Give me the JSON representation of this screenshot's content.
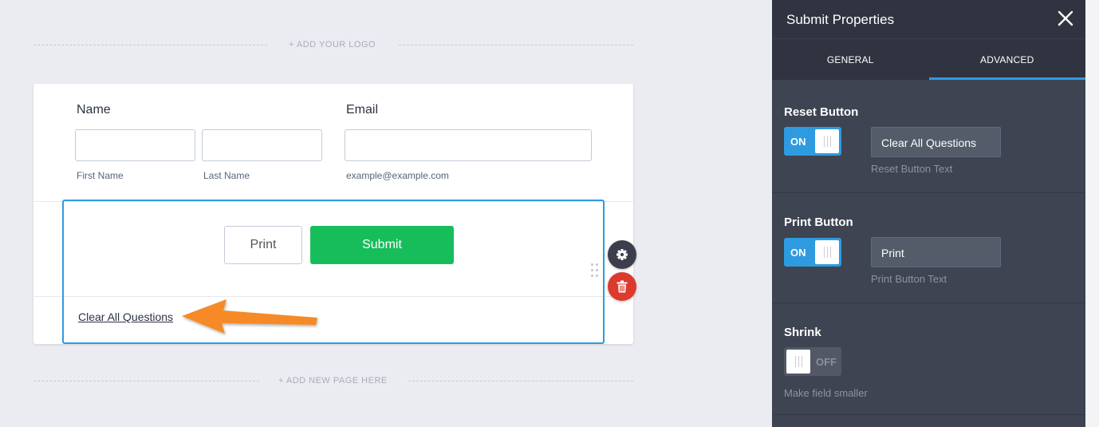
{
  "canvas": {
    "add_logo": "+ ADD YOUR LOGO",
    "add_page": "+ ADD NEW PAGE HERE"
  },
  "form": {
    "name_label": "Name",
    "email_label": "Email",
    "first_name_sub": "First Name",
    "last_name_sub": "Last Name",
    "email_sub": "example@example.com",
    "print_label": "Print",
    "submit_label": "Submit",
    "reset_label": "Clear All Questions",
    "submit_color": "#18bd5b",
    "selection_color": "#2e9be0"
  },
  "icons": {
    "settings": "gear-icon",
    "delete": "trash-icon",
    "drag": "drag-handle-icon",
    "pointer": "arrow-annotation",
    "close": "close-icon"
  },
  "panel": {
    "title": "Submit Properties",
    "tabs": [
      "GENERAL",
      "ADVANCED"
    ],
    "active_tab": "ADVANCED",
    "reset": {
      "title": "Reset Button",
      "toggle": "ON",
      "value": "Clear All Questions",
      "hint": "Reset Button Text"
    },
    "print": {
      "title": "Print Button",
      "toggle": "ON",
      "value": "Print",
      "hint": "Print Button Text"
    },
    "shrink": {
      "title": "Shrink",
      "toggle": "OFF",
      "hint": "Make field smaller"
    }
  }
}
